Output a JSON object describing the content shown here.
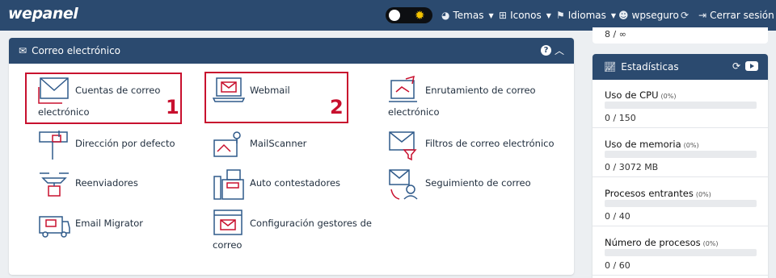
{
  "brand": {
    "logo": "wepanel"
  },
  "topbar": {
    "items": [
      {
        "label": "Temas",
        "icon": "palette-icon"
      },
      {
        "label": "Iconos",
        "icon": "sitemap-icon"
      },
      {
        "label": "Idiomas",
        "icon": "flag-icon"
      },
      {
        "label": "wpseguro",
        "icon": "user-gear-icon"
      },
      {
        "label": "Cerrar sesión",
        "icon": "sign-out-icon"
      }
    ]
  },
  "panel": {
    "title": "Correo electrónico",
    "items": [
      {
        "label": "Cuentas de correo electrónico",
        "line1": "Cuentas de correo",
        "line2": "electrónico",
        "icon": "envelope-inbox-icon",
        "highlight": "1"
      },
      {
        "label": "Webmail",
        "icon": "laptop-mail-icon",
        "highlight": "2"
      },
      {
        "label": "Enrutamiento de correo electrónico",
        "line1": "Enrutamiento de correo",
        "line2": "electrónico",
        "icon": "mail-routing-icon"
      },
      {
        "label": "Dirección por defecto",
        "icon": "mailbox-icon"
      },
      {
        "label": "MailScanner",
        "icon": "mail-scanner-icon"
      },
      {
        "label": "Filtros de correo electrónico",
        "icon": "mail-filter-icon"
      },
      {
        "label": "Reenviadores",
        "icon": "forwarder-drone-icon"
      },
      {
        "label": "Auto contestadores",
        "icon": "fax-machine-icon"
      },
      {
        "label": "Seguimiento de correo",
        "icon": "mail-tracking-icon"
      },
      {
        "label": "Email Migrator",
        "icon": "mail-truck-icon"
      },
      {
        "label": "Configuración gestores de correo",
        "line1": "Configuración gestores de",
        "line2": "correo",
        "icon": "mail-client-config-icon"
      }
    ]
  },
  "prev_box": {
    "value": "8 / ∞"
  },
  "stats": {
    "title": "Estadísticas",
    "rows": [
      {
        "name": "Uso de CPU",
        "pct": "(0%)",
        "value": "0 / 150",
        "fill": 0
      },
      {
        "name": "Uso de memoria",
        "pct": "(0%)",
        "value": "0 / 3072 MB",
        "fill": 0
      },
      {
        "name": "Procesos entrantes",
        "pct": "(0%)",
        "value": "0 / 40",
        "fill": 0
      },
      {
        "name": "Número de procesos",
        "pct": "(0%)",
        "value": "0 / 60",
        "fill": 0
      }
    ]
  },
  "colors": {
    "primary": "#2b4a6f",
    "highlight": "#c8102e",
    "icon_blue": "#2f5a8a",
    "icon_red": "#c8102e"
  }
}
